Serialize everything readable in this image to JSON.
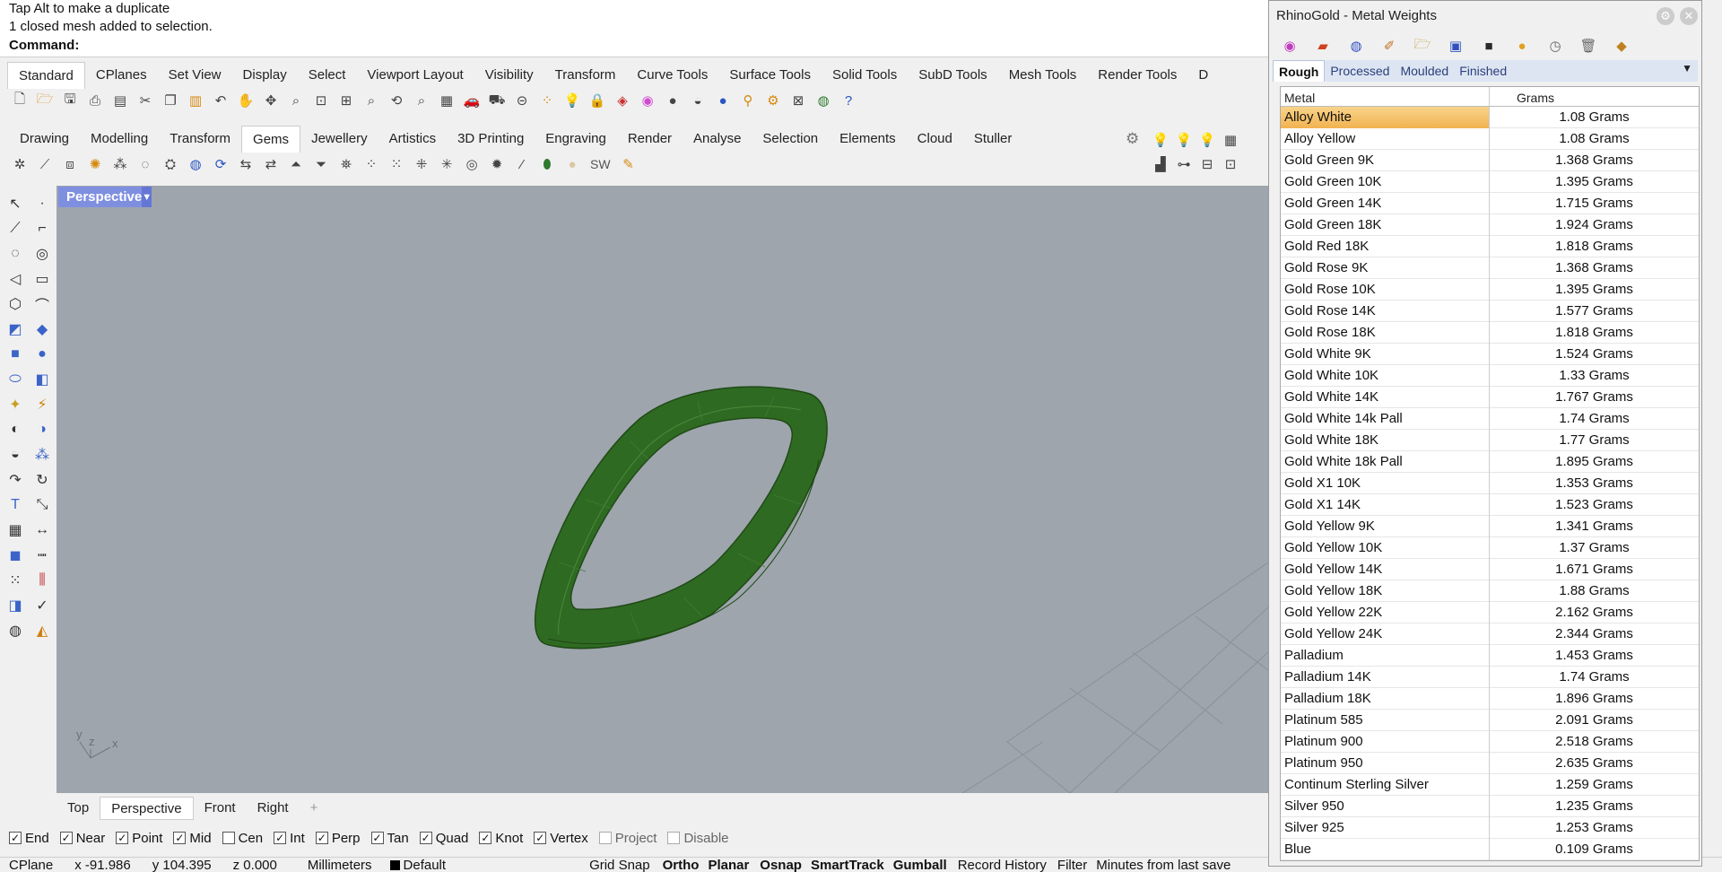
{
  "command": {
    "history": [
      "Tap Alt to make a duplicate",
      "1 closed mesh added to selection."
    ],
    "prompt": "Command:"
  },
  "toolbar_tabs": [
    "Standard",
    "CPlanes",
    "Set View",
    "Display",
    "Select",
    "Viewport Layout",
    "Visibility",
    "Transform",
    "Curve Tools",
    "Surface Tools",
    "Solid Tools",
    "SubD Tools",
    "Mesh Tools",
    "Render Tools",
    "D"
  ],
  "plugin_tabs": [
    "Drawing",
    "Modelling",
    "Transform",
    "Gems",
    "Jewellery",
    "Artistics",
    "3D Printing",
    "Engraving",
    "Render",
    "Analyse",
    "Selection",
    "Elements",
    "Cloud",
    "Stuller"
  ],
  "plugin_sw_label": "SW",
  "viewport": {
    "title": "Perspective",
    "axis": {
      "y": "y",
      "z": "z",
      "x": "x"
    }
  },
  "viewport_tabs": [
    "Top",
    "Perspective",
    "Front",
    "Right"
  ],
  "viewport_add": "+",
  "osnaps": [
    {
      "label": "End",
      "checked": true,
      "disabled": false
    },
    {
      "label": "Near",
      "checked": true,
      "disabled": false
    },
    {
      "label": "Point",
      "checked": true,
      "disabled": false
    },
    {
      "label": "Mid",
      "checked": true,
      "disabled": false
    },
    {
      "label": "Cen",
      "checked": false,
      "disabled": false
    },
    {
      "label": "Int",
      "checked": true,
      "disabled": false
    },
    {
      "label": "Perp",
      "checked": true,
      "disabled": false
    },
    {
      "label": "Tan",
      "checked": true,
      "disabled": false
    },
    {
      "label": "Quad",
      "checked": true,
      "disabled": false
    },
    {
      "label": "Knot",
      "checked": true,
      "disabled": false
    },
    {
      "label": "Vertex",
      "checked": true,
      "disabled": false
    },
    {
      "label": "Project",
      "checked": false,
      "disabled": true
    },
    {
      "label": "Disable",
      "checked": false,
      "disabled": true
    }
  ],
  "status": {
    "cplane": "CPlane",
    "x": "x -91.986",
    "y": "y 104.395",
    "z": "z 0.000",
    "units": "Millimeters",
    "layer": "Default",
    "grid_snap": "Grid Snap",
    "ortho": "Ortho",
    "planar": "Planar",
    "osnap": "Osnap",
    "smarttrack": "SmartTrack",
    "gumball": "Gumball",
    "record_history": "Record History",
    "filter": "Filter",
    "minutes": "Minutes from last save"
  },
  "panel": {
    "title": "RhinoGold - Metal Weights",
    "tabs": [
      "Rough",
      "Processed",
      "Moulded",
      "Finished"
    ],
    "active_tab": "Rough",
    "columns": [
      "Metal",
      "Grams"
    ],
    "rows": [
      {
        "metal": "Alloy White",
        "grams": "1.08 Grams"
      },
      {
        "metal": "Alloy Yellow",
        "grams": "1.08 Grams"
      },
      {
        "metal": "Gold Green 9K",
        "grams": "1.368 Grams"
      },
      {
        "metal": "Gold Green 10K",
        "grams": "1.395 Grams"
      },
      {
        "metal": "Gold Green 14K",
        "grams": "1.715 Grams"
      },
      {
        "metal": "Gold Green 18K",
        "grams": "1.924 Grams"
      },
      {
        "metal": "Gold Red 18K",
        "grams": "1.818 Grams"
      },
      {
        "metal": "Gold Rose 9K",
        "grams": "1.368 Grams"
      },
      {
        "metal": "Gold Rose 10K",
        "grams": "1.395 Grams"
      },
      {
        "metal": "Gold Rose 14K",
        "grams": "1.577 Grams"
      },
      {
        "metal": "Gold Rose 18K",
        "grams": "1.818 Grams"
      },
      {
        "metal": "Gold White 9K",
        "grams": "1.524 Grams"
      },
      {
        "metal": "Gold White 10K",
        "grams": "1.33 Grams"
      },
      {
        "metal": "Gold White 14K",
        "grams": "1.767 Grams"
      },
      {
        "metal": "Gold White 14k Pall",
        "grams": "1.74 Grams"
      },
      {
        "metal": "Gold White 18K",
        "grams": "1.77 Grams"
      },
      {
        "metal": "Gold White 18k Pall",
        "grams": "1.895 Grams"
      },
      {
        "metal": "Gold X1 10K",
        "grams": "1.353 Grams"
      },
      {
        "metal": "Gold X1 14K",
        "grams": "1.523 Grams"
      },
      {
        "metal": "Gold Yellow 9K",
        "grams": "1.341 Grams"
      },
      {
        "metal": "Gold Yellow 10K",
        "grams": "1.37 Grams"
      },
      {
        "metal": "Gold Yellow 14K",
        "grams": "1.671 Grams"
      },
      {
        "metal": "Gold Yellow 18K",
        "grams": "1.88 Grams"
      },
      {
        "metal": "Gold Yellow 22K",
        "grams": "2.162 Grams"
      },
      {
        "metal": "Gold Yellow 24K",
        "grams": "2.344 Grams"
      },
      {
        "metal": "Palladium",
        "grams": "1.453 Grams"
      },
      {
        "metal": "Palladium 14K",
        "grams": "1.74 Grams"
      },
      {
        "metal": "Palladium 18K",
        "grams": "1.896 Grams"
      },
      {
        "metal": "Platinum 585",
        "grams": "2.091 Grams"
      },
      {
        "metal": "Platinum 900",
        "grams": "2.518 Grams"
      },
      {
        "metal": "Platinum 950",
        "grams": "2.635 Grams"
      },
      {
        "metal": "Continum Sterling Silver",
        "grams": "1.259 Grams"
      },
      {
        "metal": "Silver 950",
        "grams": "1.235 Grams"
      },
      {
        "metal": "Silver 925",
        "grams": "1.253 Grams"
      },
      {
        "metal": "Blue",
        "grams": "0.109 Grams"
      }
    ]
  },
  "colors": {
    "viewport_bg": "#9ea5ad",
    "viewport_title": "#7f8fe0",
    "mesh_green": "#2f6a22",
    "selected_row": "#f2b250"
  }
}
